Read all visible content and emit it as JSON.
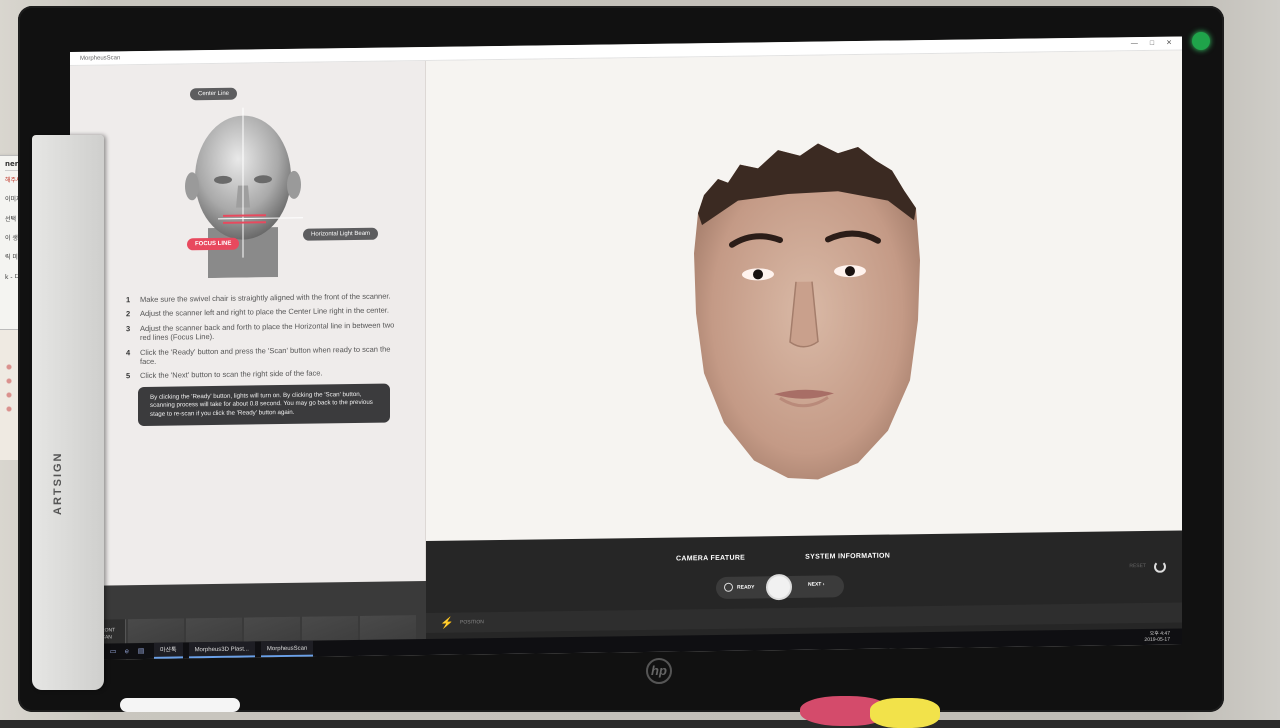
{
  "window": {
    "title": "MorpheusScan",
    "controls": [
      "—",
      "□",
      "✕"
    ]
  },
  "guide": {
    "callouts": {
      "center_line": "Center Line",
      "horizontal_beam": "Horizontal Light Beam",
      "focus_line": "FOCUS LINE"
    },
    "steps": [
      {
        "n": "1",
        "text": "Make sure the swivel chair is straightly aligned with the front of the scanner."
      },
      {
        "n": "2",
        "text": "Adjust the scanner left and right to place the Center Line right in the center."
      },
      {
        "n": "3",
        "text": "Adjust the scanner back and forth to place the Horizontal line in between two red lines (Focus Line)."
      },
      {
        "n": "4",
        "text": "Click the 'Ready' button and press the 'Scan' button when ready to scan the face."
      },
      {
        "n": "5",
        "text": "Click the 'Next' button to scan the right side of the face."
      }
    ],
    "note": "By clicking the 'Ready' button, lights will turn on. By clicking the 'Scan' button, scanning process will take for about 0.8 second. You may go back to the previous stage to re-scan if you click the 'Ready' button again."
  },
  "thumbs": {
    "front_label": "FRONT SCAN"
  },
  "controls": {
    "tab_camera": "CAMERA FEATURE",
    "tab_system": "SYSTEM INFORMATION",
    "ready": "READY",
    "next": "NEXT",
    "reset": "RESET",
    "position": "POSITION"
  },
  "taskbar": {
    "start_icon": "windows-icon",
    "search_icon": "search-icon",
    "items": [
      "마샨톡",
      "Morpheus3D Plast...",
      "MorpheusScan"
    ],
    "tray_time": "오후 4:47",
    "tray_date": "2019-05-17"
  },
  "surroundings": {
    "sticky_note": {
      "head": "ner",
      "lines": [
        "해주세요.",
        "이미지탭의",
        "선택",
        "이 생김",
        "릭 미지 click",
        "k - 디스크 찾음 click"
      ]
    },
    "monitor_side_brand": "ARTSIGN",
    "monitor_logo": "hp"
  },
  "colors": {
    "focus_red": "#e8495e",
    "callout_gray": "#5d5d5f",
    "control_bg": "#262626",
    "screen_bg": "#f6f4f1",
    "power_led": "#1fa34a"
  }
}
